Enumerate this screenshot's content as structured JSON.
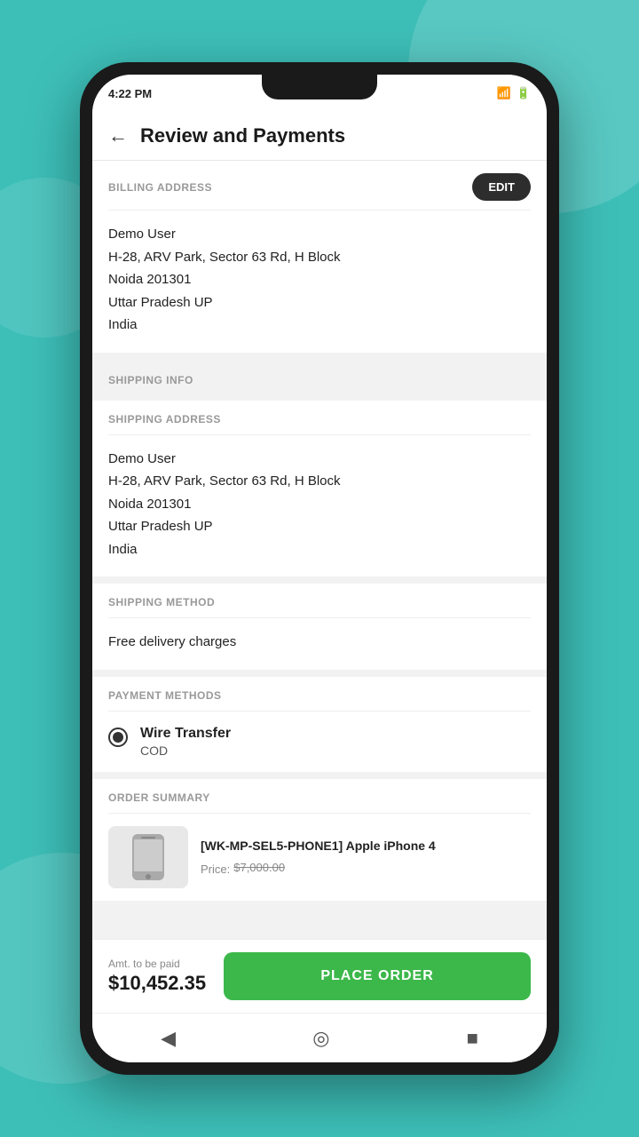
{
  "status_bar": {
    "time": "4:22 PM",
    "icons": "⛔ 📶 🔋"
  },
  "header": {
    "title": "Review and Payments",
    "back_label": "‹"
  },
  "billing": {
    "section_label": "BILLING ADDRESS",
    "edit_button": "EDIT",
    "name": "Demo User",
    "address1": "H-28, ARV Park, Sector 63 Rd, H Block",
    "address2": "Noida 201301",
    "address3": "Uttar Pradesh UP",
    "country": "India"
  },
  "shipping_info": {
    "section_label": "SHIPPING INFO",
    "address_label": "SHIPPING ADDRESS",
    "name": "Demo User",
    "address1": "H-28, ARV Park, Sector 63 Rd, H Block",
    "address2": "Noida 201301",
    "address3": "Uttar Pradesh UP",
    "country": "India"
  },
  "shipping_method": {
    "section_label": "SHIPPING METHOD",
    "value": "Free delivery charges"
  },
  "payment_methods": {
    "section_label": "PAYMENT METHODS",
    "selected_name": "Wire Transfer",
    "selected_sub": "COD"
  },
  "order_summary": {
    "section_label": "ORDER SUMMARY",
    "product_name": "[WK-MP-SEL5-PHONE1] Apple iPhone 4",
    "price_label": "Price:",
    "price_value": "$7,000.00"
  },
  "footer": {
    "amt_label": "Amt. to be paid",
    "amt_value": "$10,452.35",
    "place_order_label": "PLACE ORDER"
  },
  "nav": {
    "back": "◀",
    "home": "◎",
    "square": "■"
  }
}
